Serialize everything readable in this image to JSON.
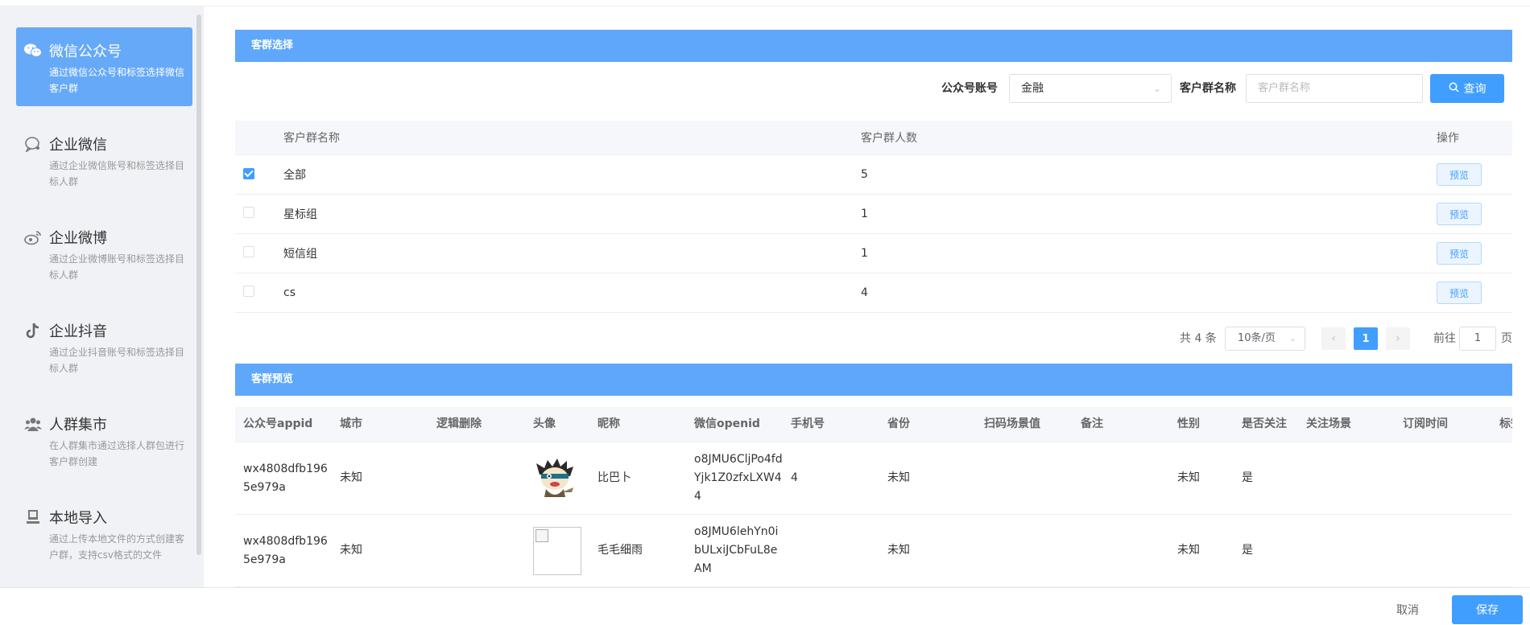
{
  "sidebar": {
    "items": [
      {
        "title": "微信公众号",
        "desc": "通过微信公众号和标签选择微信客户群",
        "icon": "wechat-icon",
        "active": true
      },
      {
        "title": "企业微信",
        "desc": "通过企业微信账号和标签选择目标人群",
        "icon": "wecom-icon",
        "active": false
      },
      {
        "title": "企业微博",
        "desc": "通过企业微博账号和标签选择目标人群",
        "icon": "weibo-icon",
        "active": false
      },
      {
        "title": "企业抖音",
        "desc": "通过企业抖音账号和标签选择目标人群",
        "icon": "tiktok-icon",
        "active": false
      },
      {
        "title": "人群集市",
        "desc": "在人群集市通过选择人群包进行客户群创建",
        "icon": "users-icon",
        "active": false
      },
      {
        "title": "本地导入",
        "desc": "通过上传本地文件的方式创建客户群，支持csv格式的文件",
        "icon": "computer-icon",
        "active": false
      }
    ]
  },
  "group_select": {
    "title": "客群选择",
    "account_label": "公众号账号",
    "account_value": "金融",
    "name_label": "客户群名称",
    "name_placeholder": "客户群名称",
    "query_label": "查询",
    "columns": [
      "客户群名称",
      "客户群人数",
      "操作"
    ],
    "rows": [
      {
        "name": "全部",
        "count": "5",
        "checked": true,
        "action": "预览"
      },
      {
        "name": "星标组",
        "count": "1",
        "checked": false,
        "action": "预览"
      },
      {
        "name": "短信组",
        "count": "1",
        "checked": false,
        "action": "预览"
      },
      {
        "name": "cs",
        "count": "4",
        "checked": false,
        "action": "预览"
      }
    ]
  },
  "pagination": {
    "total": "共 4 条",
    "page_size": "10条/页",
    "current": "1",
    "goto_label": "前往",
    "goto_value": "1",
    "page_suffix": "页"
  },
  "preview": {
    "title": "客群预览",
    "columns": [
      "公众号appid",
      "城市",
      "逻辑删除",
      "头像",
      "昵称",
      "微信openid",
      "手机号",
      "省份",
      "扫码场景值",
      "备注",
      "性别",
      "是否关注",
      "关注场景",
      "订阅时间",
      "标签"
    ],
    "rows": [
      {
        "appid": "wx4808dfb1965e979a",
        "city": "未知",
        "deleted": "",
        "avatar": "cartoon",
        "nickname": "比巴卜",
        "openid": "o8JMU6CljPo4fdYjk1Z0zfxLXW44",
        "phone": "4",
        "province": "未知",
        "scene": "",
        "remark": "",
        "gender": "未知",
        "followed": "是",
        "follow_scene": "",
        "sub_time": "",
        "tags": ""
      },
      {
        "appid": "wx4808dfb1965e979a",
        "city": "未知",
        "deleted": "",
        "avatar": "broken",
        "nickname": "毛毛细雨",
        "openid": "o8JMU6lehYn0ibULxiJCbFuL8eAM",
        "phone": "",
        "province": "未知",
        "scene": "",
        "remark": "",
        "gender": "未知",
        "followed": "是",
        "follow_scene": "",
        "sub_time": "",
        "tags": ""
      }
    ]
  },
  "footer": {
    "cancel": "取消",
    "save": "保存"
  },
  "colors": {
    "accent": "#409eff",
    "section_bar": "#5ea7fb",
    "sidebar_active": "#66a9f9",
    "sidebar_bg": "#f0f2f5"
  }
}
